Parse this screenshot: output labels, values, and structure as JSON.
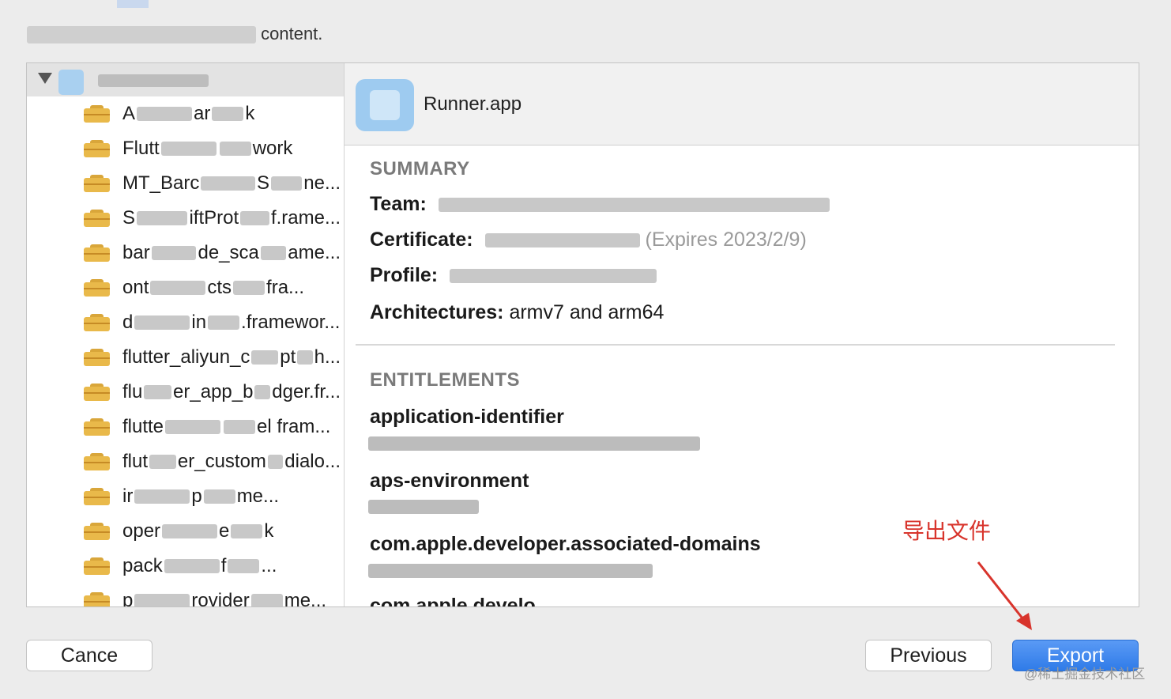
{
  "dialog": {
    "title_suffix": "content."
  },
  "sidebar": {
    "items": [
      {
        "prefix": "A",
        "middle": "ar",
        "suffix": "k"
      },
      {
        "prefix": "Flutt",
        "middle": "",
        "suffix": "work"
      },
      {
        "prefix": "MT_Barc",
        "middle": "S",
        "suffix": "ne..."
      },
      {
        "prefix": "S",
        "middle": "iftProt",
        "suffix": "f.rame..."
      },
      {
        "prefix": "bar",
        "middle": "de_sca",
        "suffix": "ame..."
      },
      {
        "prefix": "ont",
        "middle": "cts",
        "suffix": "fra..."
      },
      {
        "prefix": "d",
        "middle": "in",
        "suffix": ".framewor..."
      },
      {
        "prefix": "flutter_aliyun_c",
        "middle": "pt",
        "suffix": "h..."
      },
      {
        "prefix": "flu",
        "middle": "er_app_b",
        "suffix": "dger.fr..."
      },
      {
        "prefix": "flutte",
        "middle": "",
        "suffix": "el fram..."
      },
      {
        "prefix": "flut",
        "middle": "er_custom",
        "suffix": "dialo..."
      },
      {
        "prefix": "ir",
        "middle": "p",
        "suffix": "me..."
      },
      {
        "prefix": "oper",
        "middle": "e",
        "suffix": "k"
      },
      {
        "prefix": "pack",
        "middle": "f",
        "suffix": "..."
      },
      {
        "prefix": "p",
        "middle": "rovider",
        "suffix": "me..."
      }
    ]
  },
  "main": {
    "app_name": "Runner.app",
    "summary_label": "SUMMARY",
    "team_label": "Team:",
    "certificate_label": "Certificate:",
    "certificate_expiry": "(Expires 2023/2/9)",
    "profile_label": "Profile:",
    "architectures_label": "Architectures:",
    "architectures_value": "armv7 and arm64",
    "entitlements_label": "ENTITLEMENTS",
    "entitlements": [
      "application-identifier",
      "aps-environment",
      "com.apple.developer.associated-domains",
      "com.apple.develo"
    ]
  },
  "annotation": {
    "text": "导出文件",
    "color": "#d8342c"
  },
  "buttons": {
    "cancel": "Cance",
    "previous": "Previous",
    "export": "Export"
  },
  "watermark": "@稀土掘金技术社区",
  "colors": {
    "accent": "#2f7be8",
    "folder": "#e9b94a",
    "annotation": "#d8342c"
  }
}
